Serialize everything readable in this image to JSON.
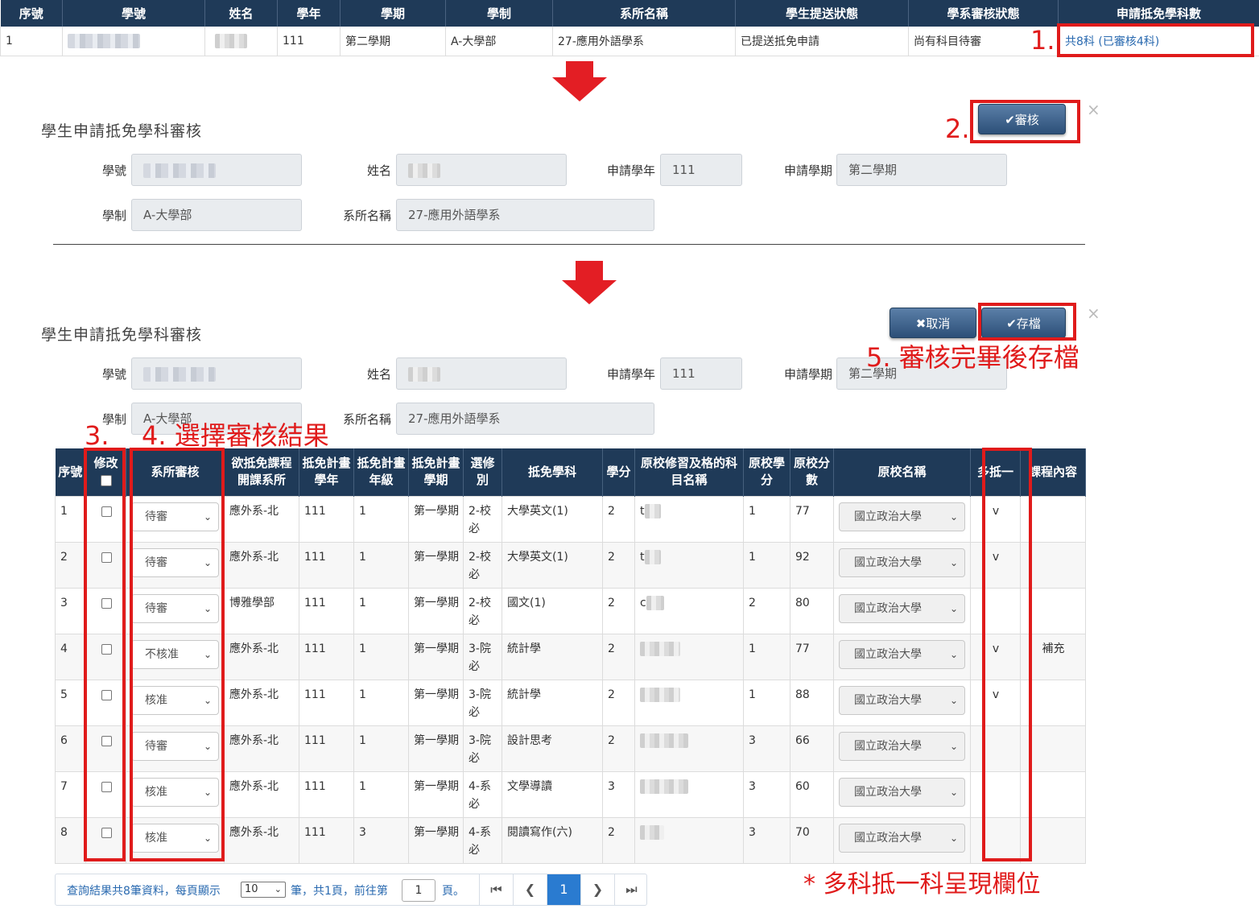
{
  "top_table": {
    "headers": [
      "序號",
      "學號",
      "姓名",
      "學年",
      "學期",
      "學制",
      "系所名稱",
      "學生提送狀態",
      "學系審核狀態",
      "申請抵免學科數"
    ],
    "row": {
      "seq": "1",
      "year": "111",
      "semester": "第二學期",
      "system": "A-大學部",
      "dept": "27-應用外語學系",
      "student_status": "已提送抵免申請",
      "review_status": "尚有科目待審",
      "count_link": "共8科 (已審核4科)"
    }
  },
  "annotations": {
    "step1": "1.",
    "step2": "2.",
    "step3": "3.",
    "step4": "4. 選擇審核結果",
    "step5": "5. 審核完畢後存檔",
    "note": "* 多科抵一科呈現欄位"
  },
  "panel1": {
    "title": "學生申請抵免學科審核",
    "review_button": "✔審核",
    "close": "×",
    "labels": {
      "student_id": "學號",
      "name": "姓名",
      "apply_year": "申請學年",
      "apply_semester": "申請學期",
      "system": "學制",
      "dept": "系所名稱"
    },
    "values": {
      "apply_year": "111",
      "apply_semester": "第二學期",
      "system": "A-大學部",
      "dept": "27-應用外語學系"
    }
  },
  "panel2": {
    "title": "學生申請抵免學科審核",
    "cancel_button": "✖取消",
    "save_button": "✔存檔",
    "close": "×",
    "labels": {
      "student_id": "學號",
      "name": "姓名",
      "apply_year": "申請學年",
      "apply_semester": "申請學期",
      "system": "學制",
      "dept": "系所名稱"
    },
    "values": {
      "apply_year": "111",
      "apply_semester": "第二學期",
      "system": "A-大學部",
      "dept": "27-應用外語學系"
    }
  },
  "review_table": {
    "headers": {
      "seq": "序號",
      "modify": "修改",
      "review": "系所審核",
      "course_dept": "欲抵免課程開課系所",
      "plan_year": "抵免計畫學年",
      "plan_grade": "抵免計畫年級",
      "plan_sem": "抵免計畫學期",
      "elective": "選修別",
      "subject": "抵免學科",
      "credits": "學分",
      "orig_subject": "原校修習及格的科目名稱",
      "orig_credits": "原校學分",
      "orig_score": "原校分數",
      "orig_school": "原校名稱",
      "multi": "多抵一",
      "content": "課程內容"
    },
    "rows": [
      {
        "seq": "1",
        "review": "待審",
        "course_dept": "應外系-北",
        "plan_year": "111",
        "plan_grade": "1",
        "plan_sem": "第一學期",
        "elective": "2-校必",
        "subject": "大學英文(1)",
        "credits": "2",
        "orig_prefix": "t",
        "orig_credits": "1",
        "orig_score": "77",
        "school": "國立政治大學",
        "multi": "v",
        "content": ""
      },
      {
        "seq": "2",
        "review": "待審",
        "course_dept": "應外系-北",
        "plan_year": "111",
        "plan_grade": "1",
        "plan_sem": "第一學期",
        "elective": "2-校必",
        "subject": "大學英文(1)",
        "credits": "2",
        "orig_prefix": "t",
        "orig_credits": "1",
        "orig_score": "92",
        "school": "國立政治大學",
        "multi": "v",
        "content": ""
      },
      {
        "seq": "3",
        "review": "待審",
        "course_dept": "博雅學部",
        "plan_year": "111",
        "plan_grade": "1",
        "plan_sem": "第一學期",
        "elective": "2-校必",
        "subject": "國文(1)",
        "credits": "2",
        "orig_prefix": "c",
        "orig_credits": "2",
        "orig_score": "80",
        "school": "國立政治大學",
        "multi": "",
        "content": ""
      },
      {
        "seq": "4",
        "review": "不核准",
        "course_dept": "應外系-北",
        "plan_year": "111",
        "plan_grade": "1",
        "plan_sem": "第一學期",
        "elective": "3-院必",
        "subject": "統計學",
        "credits": "2",
        "orig_prefix": "",
        "orig_credits": "1",
        "orig_score": "77",
        "school": "國立政治大學",
        "multi": "v",
        "content": "補充"
      },
      {
        "seq": "5",
        "review": "核准",
        "course_dept": "應外系-北",
        "plan_year": "111",
        "plan_grade": "1",
        "plan_sem": "第一學期",
        "elective": "3-院必",
        "subject": "統計學",
        "credits": "2",
        "orig_prefix": "",
        "orig_credits": "1",
        "orig_score": "88",
        "school": "國立政治大學",
        "multi": "v",
        "content": ""
      },
      {
        "seq": "6",
        "review": "待審",
        "course_dept": "應外系-北",
        "plan_year": "111",
        "plan_grade": "1",
        "plan_sem": "第一學期",
        "elective": "3-院必",
        "subject": "設計思考",
        "credits": "2",
        "orig_prefix": "",
        "orig_credits": "3",
        "orig_score": "66",
        "school": "國立政治大學",
        "multi": "",
        "content": ""
      },
      {
        "seq": "7",
        "review": "核准",
        "course_dept": "應外系-北",
        "plan_year": "111",
        "plan_grade": "1",
        "plan_sem": "第一學期",
        "elective": "4-系必",
        "subject": "文學導讀",
        "credits": "3",
        "orig_prefix": "",
        "orig_credits": "3",
        "orig_score": "60",
        "school": "國立政治大學",
        "multi": "",
        "content": ""
      },
      {
        "seq": "8",
        "review": "核准",
        "course_dept": "應外系-北",
        "plan_year": "111",
        "plan_grade": "3",
        "plan_sem": "第一學期",
        "elective": "4-系必",
        "subject": "閱讀寫作(六)",
        "credits": "2",
        "orig_prefix": "",
        "orig_credits": "3",
        "orig_score": "70",
        "school": "國立政治大學",
        "multi": "",
        "content": ""
      }
    ]
  },
  "pagination": {
    "summary_prefix": "查詢結果共8筆資料，每頁顯示",
    "page_size": "10",
    "summary_middle": "筆，共1頁，前往第",
    "goto_value": "1",
    "summary_suffix": "頁。",
    "current_page": "1"
  }
}
